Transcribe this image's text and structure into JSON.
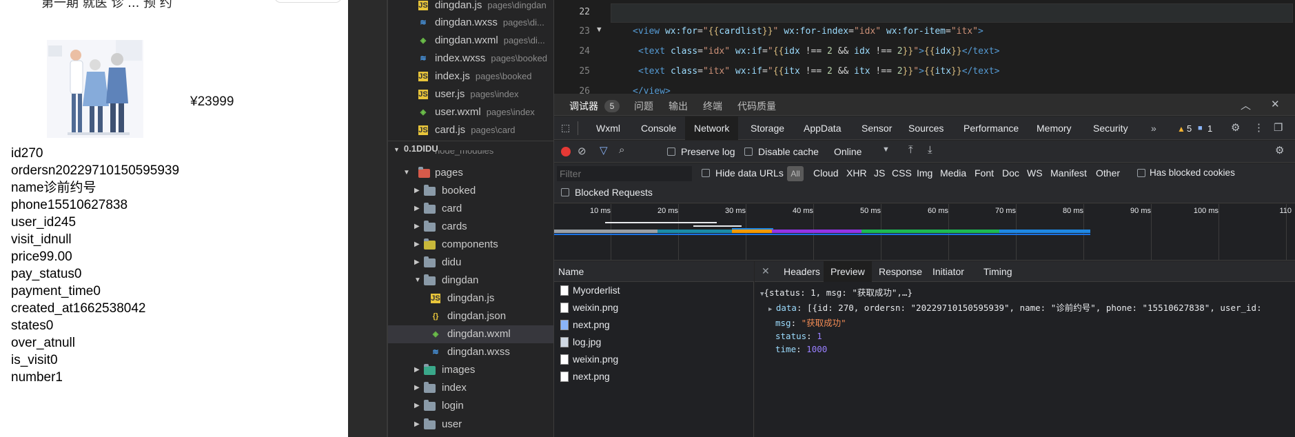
{
  "simulator": {
    "top_text": "第一期 就医 诊 ... 预 约",
    "price": "¥23999",
    "fields": [
      "id270",
      "ordersn20229710150595939",
      "name诊前约号",
      "phone15510627838",
      "user_id245",
      "visit_idnull",
      "price99.00",
      "pay_status0",
      "payment_time0",
      "created_at1662538042",
      "states0",
      "over_atnull",
      "is_visit0",
      "number1"
    ]
  },
  "explorer": {
    "open_files": [
      {
        "name": "dingdan.js",
        "path": "pages\\dingdan",
        "icon": "js-icon"
      },
      {
        "name": "dingdan.wxss",
        "path": "pages\\di...",
        "icon": "css-icon"
      },
      {
        "name": "dingdan.wxml",
        "path": "pages\\di...",
        "icon": "wxml-icon"
      },
      {
        "name": "index.wxss",
        "path": "pages\\booked",
        "icon": "css-icon"
      },
      {
        "name": "index.js",
        "path": "pages\\booked",
        "icon": "js-icon"
      },
      {
        "name": "user.js",
        "path": "pages\\index",
        "icon": "js-icon"
      },
      {
        "name": "user.wxml",
        "path": "pages\\index",
        "icon": "wxml-icon"
      },
      {
        "name": "card.js",
        "path": "pages\\card",
        "icon": "js-icon"
      }
    ],
    "project_name": "0.1DIDU",
    "partial_item": "node_modules",
    "tree": [
      {
        "label": "pages",
        "kind": "folder",
        "expanded": true
      },
      {
        "label": "booked",
        "kind": "folder"
      },
      {
        "label": "card",
        "kind": "folder"
      },
      {
        "label": "cards",
        "kind": "folder"
      },
      {
        "label": "components",
        "kind": "folder"
      },
      {
        "label": "didu",
        "kind": "folder"
      },
      {
        "label": "dingdan",
        "kind": "folder",
        "expanded": true
      },
      {
        "label": "dingdan.js",
        "kind": "js"
      },
      {
        "label": "dingdan.json",
        "kind": "json"
      },
      {
        "label": "dingdan.wxml",
        "kind": "wxml",
        "selected": true
      },
      {
        "label": "dingdan.wxss",
        "kind": "css"
      },
      {
        "label": "images",
        "kind": "folder"
      },
      {
        "label": "index",
        "kind": "folder"
      },
      {
        "label": "login",
        "kind": "folder"
      },
      {
        "label": "user",
        "kind": "folder"
      }
    ]
  },
  "editor": {
    "line_numbers": [
      "22",
      "23",
      "24",
      "25",
      "26"
    ],
    "lines": [
      "",
      "<view wx:for=\"{{cardlist}}\" wx:for-index=\"idx\" wx:for-item=\"itx\">",
      "<text class=\"idx\" wx:if=\"{{idx !== 2 && idx !== 2}}\">{{idx}}</text>",
      "<text class=\"itx\" wx:if=\"{{itx !== 2 && itx !== 2}}\">{{itx}}</text>",
      "</view>"
    ]
  },
  "devtools": {
    "top_tabs": [
      "调试器",
      "问题",
      "输出",
      "终端",
      "代码质量"
    ],
    "debugger_badge": "5",
    "panel_tabs": [
      "Wxml",
      "Console",
      "Network",
      "Storage",
      "AppData",
      "Sensor",
      "Sources",
      "Performance",
      "Memory",
      "Security"
    ],
    "active_panel": "Network",
    "warn_count": "5",
    "info_count": "1",
    "toolbar": {
      "preserve_log": "Preserve log",
      "disable_cache": "Disable cache",
      "throttle": "Online"
    },
    "filter": {
      "placeholder": "Filter",
      "hide_data_urls": "Hide data URLs",
      "all": "All",
      "types": [
        "Cloud",
        "XHR",
        "JS",
        "CSS",
        "Img",
        "Media",
        "Font",
        "Doc",
        "WS",
        "Manifest",
        "Other"
      ],
      "has_blocked_cookies": "Has blocked cookies",
      "blocked_requests": "Blocked Requests"
    },
    "timeline_ticks": [
      "10 ms",
      "20 ms",
      "30 ms",
      "40 ms",
      "50 ms",
      "60 ms",
      "70 ms",
      "80 ms",
      "90 ms",
      "100 ms",
      "110"
    ],
    "requests_header": "Name",
    "requests": [
      "Myorderlist",
      "weixin.png",
      "next.png",
      "log.jpg",
      "weixin.png",
      "next.png"
    ],
    "detail_tabs": [
      "Headers",
      "Preview",
      "Response",
      "Initiator",
      "Timing"
    ],
    "active_detail": "Preview",
    "preview": {
      "summary": "{status: 1, msg: \"获取成功\",…}",
      "data_key": "data",
      "data_value": "[{id: 270, ordersn: \"20229710150595939\", name: \"诊前约号\", phone: \"15510627838\", user_id:",
      "msg_key": "msg",
      "msg_value": "\"获取成功\"",
      "status_key": "status",
      "status_value": "1",
      "time_key": "time",
      "time_value": "1000"
    }
  }
}
